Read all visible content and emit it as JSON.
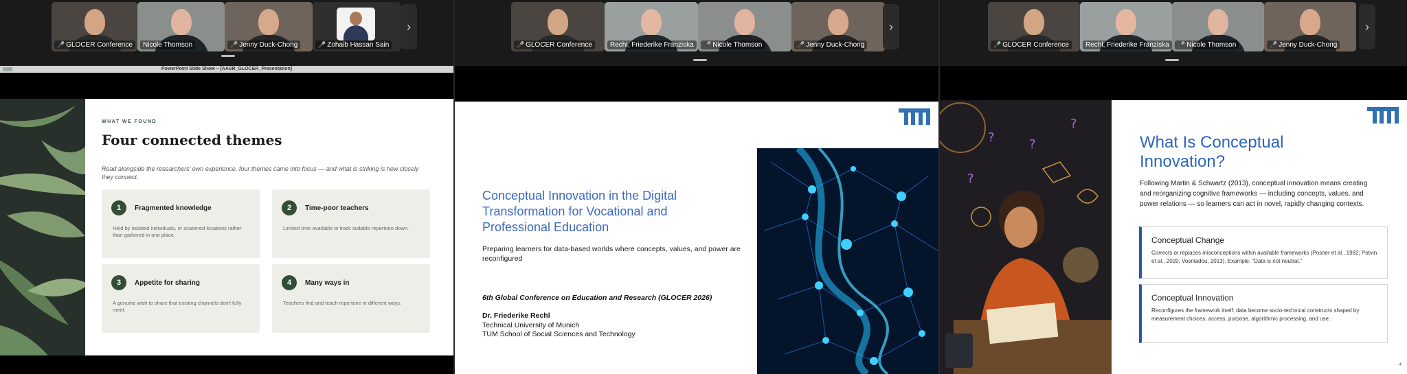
{
  "panel1": {
    "participants": [
      {
        "name": "GLOCER Conference",
        "muted": true
      },
      {
        "name": "Nicole Thomson",
        "muted": false,
        "active": true
      },
      {
        "name": "Jenny Duck-Chong",
        "muted": true
      },
      {
        "name": "Zohaib Hassan Sain",
        "muted": true
      }
    ],
    "window_title": "PowerPoint Slide Show – [AASR_GLOCER_Presentation]",
    "slide": {
      "kicker": "WHAT WE FOUND",
      "title": "Four connected themes",
      "intro": "Read alongside the researchers' own experience, four themes came into focus — and what is striking is how closely they connect.",
      "cards": [
        {
          "num": "1",
          "title": "Fragmented knowledge",
          "text": "Held by isolated individuals, or scattered locations rather than gathered in one place."
        },
        {
          "num": "2",
          "title": "Time-poor teachers",
          "text": "Limited time available to track suitable repertoire down."
        },
        {
          "num": "3",
          "title": "Appetite for sharing",
          "text": "A genuine wish to share that existing channels don't fully meet."
        },
        {
          "num": "4",
          "title": "Many ways in",
          "text": "Teachers find and teach repertoire in different ways."
        }
      ]
    }
  },
  "panel2": {
    "participants": [
      {
        "name": "GLOCER Conference",
        "muted": true
      },
      {
        "name": "Rechl, Friederike Franziska",
        "muted": false,
        "active": true
      },
      {
        "name": "Nicole Thomson",
        "muted": true
      },
      {
        "name": "Jenny Duck-Chong",
        "muted": true
      }
    ],
    "slide": {
      "logo": "TUM",
      "title": "Conceptual Innovation in the Digital Transformation for Vocational and Professional Education",
      "subtitle": "Preparing learners for data-based worlds where concepts, values, and power are reconfigured",
      "conference": "6th Global Conference on Education and Research (GLOCER 2026)",
      "author": "Dr. Friederike Rechl",
      "affiliation1": "Technical University of Munich",
      "affiliation2": "TUM School of Social Sciences and Technology"
    }
  },
  "panel3": {
    "participants": [
      {
        "name": "GLOCER Conference",
        "muted": true
      },
      {
        "name": "Rechl, Friederike Franziska",
        "muted": false,
        "active": true
      },
      {
        "name": "Nicole Thomson",
        "muted": true
      },
      {
        "name": "Jenny Duck-Chong",
        "muted": true
      }
    ],
    "slide": {
      "logo": "TUM",
      "title": "What Is Conceptual Innovation?",
      "intro": "Following Martin & Schwartz (2013), conceptual innovation means creating and reorganizing cognitive frameworks — including concepts, values, and power relations — so learners can act in novel, rapidly changing contexts.",
      "boxes": [
        {
          "title": "Conceptual Change",
          "text": "Corrects or replaces misconceptions within available frameworks (Posner et al., 1982; Potvin et al., 2020; Vosniadou, 2013). Example: \"Data is not neutral.\""
        },
        {
          "title": "Conceptual Innovation",
          "text": "Reconfigures the framework itself: data become socio-technical constructs shaped by measurement choices, access, purpose, algorithmic processing, and use."
        }
      ],
      "page_number": "4"
    }
  },
  "icons": {
    "next": "chevron-right-icon",
    "mic": "mic-muted-icon"
  },
  "colors": {
    "accent_green": "#3ab54a",
    "tum_blue": "#3070b3",
    "card_green": "#344d36",
    "muted_red": "#e0413f"
  }
}
